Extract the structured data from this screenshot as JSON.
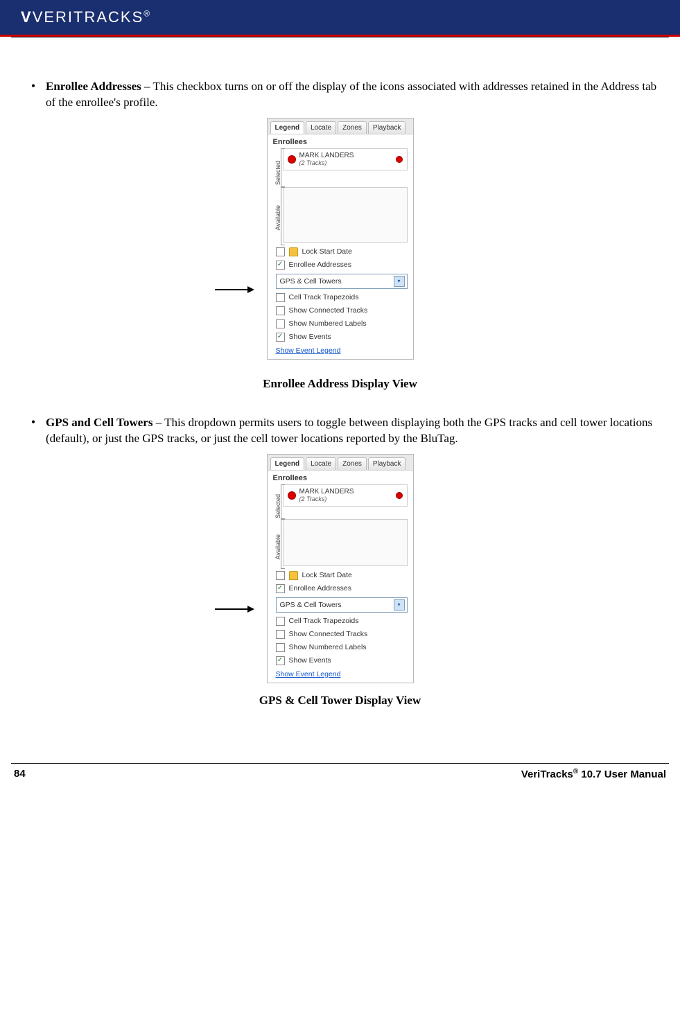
{
  "header": {
    "brand": "VERITRACKS",
    "reg": "®"
  },
  "bullets": [
    {
      "title": "Enrollee Addresses",
      "desc": " – This checkbox turns on or off the display of the icons associated with addresses retained in the Address tab of the enrollee's profile."
    },
    {
      "title": "GPS and Cell Towers",
      "desc": " – This dropdown permits users to toggle between displaying both the GPS tracks and cell tower locations (default), or just the GPS tracks, or just the cell tower locations reported by the BluTag."
    }
  ],
  "panel": {
    "tabs": [
      "Legend",
      "Locate",
      "Zones",
      "Playback"
    ],
    "enrollees_title": "Enrollees",
    "side_selected": "Selected",
    "side_available": "Available",
    "enrollee": {
      "name": "MARK LANDERS",
      "sub": "(2 Tracks)"
    },
    "options": {
      "lock_start_date": "Lock Start Date",
      "enrollee_addresses": "Enrollee Addresses",
      "gps_cell_towers": "GPS & Cell Towers",
      "cell_track_trapezoids": "Cell Track Trapezoids",
      "show_connected_tracks": "Show Connected Tracks",
      "show_numbered_labels": "Show Numbered Labels",
      "show_events": "Show Events",
      "show_event_legend": "Show Event Legend"
    }
  },
  "captions": {
    "fig1": "Enrollee Address Display View",
    "fig2": "GPS & Cell Tower Display View"
  },
  "footer": {
    "page": "84",
    "product": "VeriTracks",
    "reg": "®",
    "tail": " 10.7 User Manual"
  }
}
